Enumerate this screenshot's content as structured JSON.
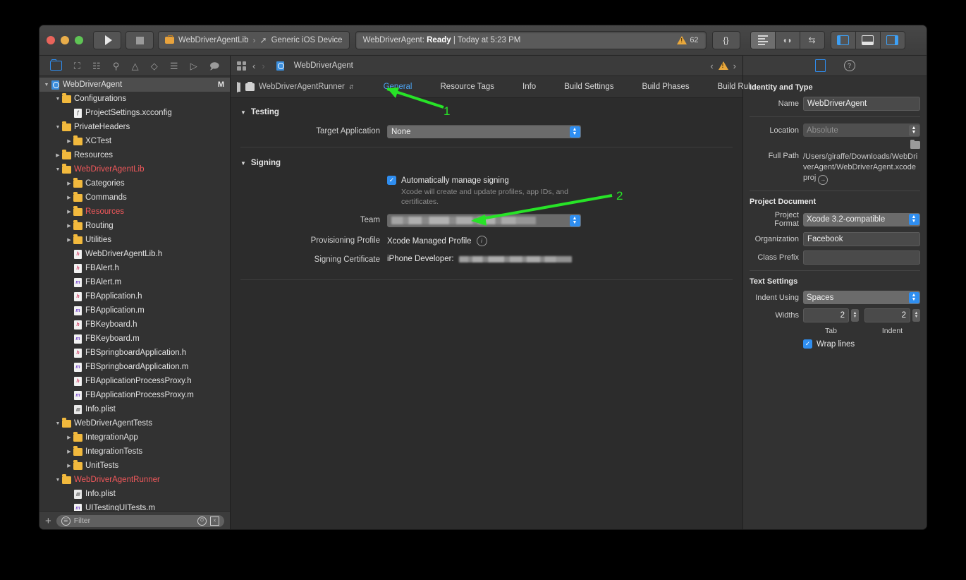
{
  "toolbar": {
    "run_icon": "play-icon",
    "stop_icon": "stop-icon",
    "scheme": "WebDriverAgentLib",
    "scheme_separator": "›",
    "destination": "Generic iOS Device",
    "status_prefix": "WebDriverAgent:",
    "status_state": "Ready",
    "status_suffix": "| Today at 5:23 PM",
    "warning_count": "62",
    "library_label": "{}",
    "editor_standard": "standard-editor-icon",
    "editor_assistant": "assistant-editor-icon",
    "editor_version": "version-editor-icon",
    "pane_left": "navigator-toggle-icon",
    "pane_bottom": "debug-area-toggle-icon",
    "pane_right": "utilities-toggle-icon"
  },
  "navigator": {
    "icons": [
      "project-navigator-icon",
      "source-control-navigator-icon",
      "symbol-navigator-icon",
      "find-navigator-icon",
      "issue-navigator-icon",
      "test-navigator-icon",
      "debug-navigator-icon",
      "breakpoint-navigator-icon",
      "report-navigator-icon"
    ],
    "filter_placeholder": "Filter",
    "add_label": "+",
    "tree": [
      {
        "label": "WebDriverAgent",
        "depth": 0,
        "kind": "project",
        "twist": "open",
        "selected": true,
        "badge": "M",
        "color": "normal"
      },
      {
        "label": "Configurations",
        "depth": 1,
        "kind": "folder",
        "twist": "open",
        "color": "normal"
      },
      {
        "label": "ProjectSettings.xcconfig",
        "depth": 2,
        "kind": "xcconfig",
        "twist": "none",
        "color": "normal"
      },
      {
        "label": "PrivateHeaders",
        "depth": 1,
        "kind": "folder",
        "twist": "open",
        "color": "normal"
      },
      {
        "label": "XCTest",
        "depth": 2,
        "kind": "folder",
        "twist": "closed",
        "color": "normal"
      },
      {
        "label": "Resources",
        "depth": 1,
        "kind": "folder",
        "twist": "closed",
        "color": "normal"
      },
      {
        "label": "WebDriverAgentLib",
        "depth": 1,
        "kind": "folder",
        "twist": "open",
        "color": "red"
      },
      {
        "label": "Categories",
        "depth": 2,
        "kind": "folder",
        "twist": "closed",
        "color": "normal"
      },
      {
        "label": "Commands",
        "depth": 2,
        "kind": "folder",
        "twist": "closed",
        "color": "normal"
      },
      {
        "label": "Resources",
        "depth": 2,
        "kind": "folder",
        "twist": "closed",
        "color": "red"
      },
      {
        "label": "Routing",
        "depth": 2,
        "kind": "folder",
        "twist": "closed",
        "color": "normal"
      },
      {
        "label": "Utilities",
        "depth": 2,
        "kind": "folder",
        "twist": "closed",
        "color": "normal"
      },
      {
        "label": "WebDriverAgentLib.h",
        "depth": 2,
        "kind": "header",
        "twist": "none",
        "color": "normal"
      },
      {
        "label": "FBAlert.h",
        "depth": 2,
        "kind": "header",
        "twist": "none",
        "color": "normal"
      },
      {
        "label": "FBAlert.m",
        "depth": 2,
        "kind": "impl",
        "twist": "none",
        "color": "normal"
      },
      {
        "label": "FBApplication.h",
        "depth": 2,
        "kind": "header",
        "twist": "none",
        "color": "normal"
      },
      {
        "label": "FBApplication.m",
        "depth": 2,
        "kind": "impl",
        "twist": "none",
        "color": "normal"
      },
      {
        "label": "FBKeyboard.h",
        "depth": 2,
        "kind": "header",
        "twist": "none",
        "color": "normal"
      },
      {
        "label": "FBKeyboard.m",
        "depth": 2,
        "kind": "impl",
        "twist": "none",
        "color": "normal"
      },
      {
        "label": "FBSpringboardApplication.h",
        "depth": 2,
        "kind": "header",
        "twist": "none",
        "color": "normal"
      },
      {
        "label": "FBSpringboardApplication.m",
        "depth": 2,
        "kind": "impl",
        "twist": "none",
        "color": "normal"
      },
      {
        "label": "FBApplicationProcessProxy.h",
        "depth": 2,
        "kind": "header",
        "twist": "none",
        "color": "normal"
      },
      {
        "label": "FBApplicationProcessProxy.m",
        "depth": 2,
        "kind": "impl",
        "twist": "none",
        "color": "normal"
      },
      {
        "label": "Info.plist",
        "depth": 2,
        "kind": "plist",
        "twist": "none",
        "color": "normal"
      },
      {
        "label": "WebDriverAgentTests",
        "depth": 1,
        "kind": "folder",
        "twist": "open",
        "color": "normal"
      },
      {
        "label": "IntegrationApp",
        "depth": 2,
        "kind": "folder",
        "twist": "closed",
        "color": "normal"
      },
      {
        "label": "IntegrationTests",
        "depth": 2,
        "kind": "folder",
        "twist": "closed",
        "color": "normal"
      },
      {
        "label": "UnitTests",
        "depth": 2,
        "kind": "folder",
        "twist": "closed",
        "color": "normal"
      },
      {
        "label": "WebDriverAgentRunner",
        "depth": 1,
        "kind": "folder",
        "twist": "open",
        "color": "red"
      },
      {
        "label": "Info.plist",
        "depth": 2,
        "kind": "plist",
        "twist": "none",
        "color": "normal"
      },
      {
        "label": "UITestingUITests.m",
        "depth": 2,
        "kind": "impl",
        "twist": "none",
        "color": "normal"
      }
    ]
  },
  "editor": {
    "jumpbar": {
      "back": "‹",
      "forward": "›",
      "title": "WebDriverAgent",
      "warn_prev": "‹",
      "warn_next": "›"
    },
    "target_name": "WebDriverAgentRunner",
    "tabs": [
      {
        "label": "General",
        "active": true
      },
      {
        "label": "Resource Tags",
        "active": false
      },
      {
        "label": "Info",
        "active": false
      },
      {
        "label": "Build Settings",
        "active": false
      },
      {
        "label": "Build Phases",
        "active": false
      },
      {
        "label": "Build Rul",
        "active": false
      }
    ],
    "testing": {
      "section_title": "Testing",
      "target_application_label": "Target Application",
      "target_application_value": "None"
    },
    "signing": {
      "section_title": "Signing",
      "auto_manage_label": "Automatically manage signing",
      "auto_manage_checked": true,
      "auto_manage_hint": "Xcode will create and update profiles, app IDs, and certificates.",
      "team_label": "Team",
      "team_value": "",
      "provisioning_label": "Provisioning Profile",
      "provisioning_value": "Xcode Managed Profile",
      "certificate_label": "Signing Certificate",
      "certificate_value": "iPhone Developer:"
    }
  },
  "inspector": {
    "tabs": [
      "file-inspector-icon",
      "quick-help-icon"
    ],
    "identity": {
      "title": "Identity and Type",
      "name_label": "Name",
      "name_value": "WebDriverAgent",
      "location_label": "Location",
      "location_value": "Absolute",
      "fullpath_label": "Full Path",
      "fullpath_value": "/Users/giraffe/Downloads/WebDriverAgent/WebDriverAgent.xcodeproj"
    },
    "project_document": {
      "title": "Project Document",
      "format_label": "Project Format",
      "format_value": "Xcode 3.2-compatible",
      "organization_label": "Organization",
      "organization_value": "Facebook",
      "class_prefix_label": "Class Prefix",
      "class_prefix_value": ""
    },
    "text_settings": {
      "title": "Text Settings",
      "indent_using_label": "Indent Using",
      "indent_using_value": "Spaces",
      "widths_label": "Widths",
      "tab_width": "2",
      "indent_width": "2",
      "tab_caption": "Tab",
      "indent_caption": "Indent",
      "wrap_lines_label": "Wrap lines",
      "wrap_lines_checked": true
    }
  },
  "annotations": [
    {
      "number": "1",
      "color": "#27e327"
    },
    {
      "number": "2",
      "color": "#27e327"
    }
  ],
  "colors": {
    "accent": "#2f8ef0",
    "annotation": "#27e327",
    "warning": "#e9a83c",
    "alert_red": "#f2585b"
  }
}
